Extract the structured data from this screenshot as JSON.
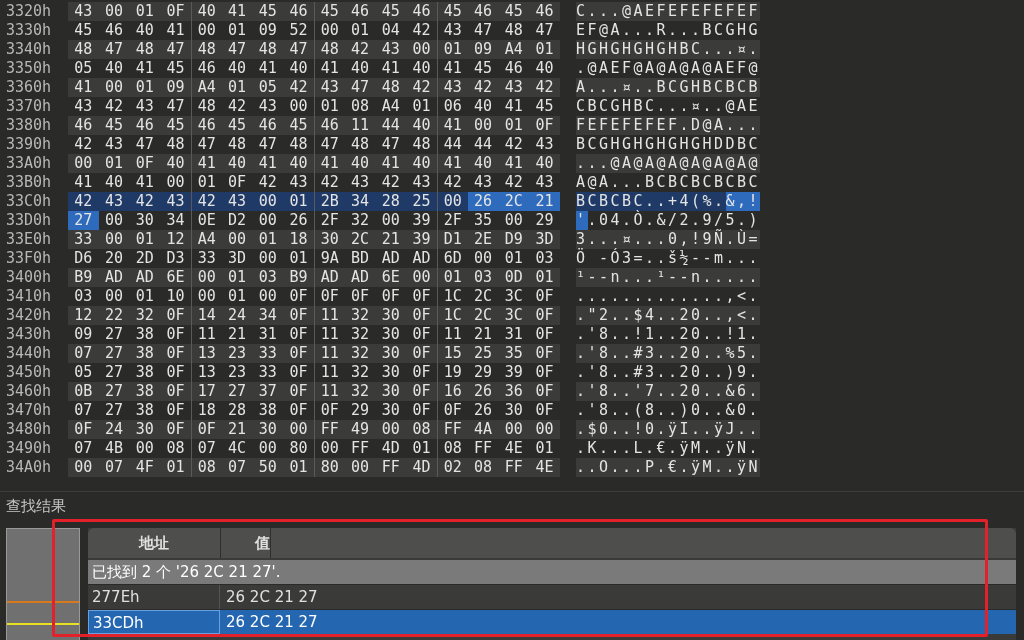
{
  "hex_view": {
    "rows": [
      {
        "offset": "3320h",
        "current": false,
        "hex": [
          {
            "bytes": "43 00 01 0F 40 41 45 46 45 46 45 46 45 46 45 46",
            "found": false
          }
        ],
        "ascii": [
          {
            "text": "C...@AEFEFEFEFEF",
            "found": false
          }
        ]
      },
      {
        "offset": "3330h",
        "current": false,
        "hex": [
          {
            "bytes": "45 46 40 41 00 01 09 52 00 01 04 42 43 47 48 47",
            "found": false
          }
        ],
        "ascii": [
          {
            "text": "EF@A...R...BCGHG",
            "found": false
          }
        ]
      },
      {
        "offset": "3340h",
        "current": false,
        "hex": [
          {
            "bytes": "48 47 48 47 48 47 48 47 48 42 43 00 01 09 A4 01",
            "found": false
          }
        ],
        "ascii": [
          {
            "text": "HGHGHGHGHBC...¤.",
            "found": false
          }
        ]
      },
      {
        "offset": "3350h",
        "current": false,
        "hex": [
          {
            "bytes": "05 40 41 45 46 40 41 40 41 40 41 40 41 45 46 40",
            "found": false
          }
        ],
        "ascii": [
          {
            "text": ".@AEF@A@A@A@AEF@",
            "found": false
          }
        ]
      },
      {
        "offset": "3360h",
        "current": false,
        "hex": [
          {
            "bytes": "41 00 01 09 A4 01 05 42 43 47 48 42 43 42 43 42",
            "found": false
          }
        ],
        "ascii": [
          {
            "text": "A...¤..BCGHBCBCB",
            "found": false
          }
        ]
      },
      {
        "offset": "3370h",
        "current": false,
        "hex": [
          {
            "bytes": "43 42 43 47 48 42 43 00 01 08 A4 01 06 40 41 45",
            "found": false
          }
        ],
        "ascii": [
          {
            "text": "CBCGHBC...¤..@AE",
            "found": false
          }
        ]
      },
      {
        "offset": "3380h",
        "current": false,
        "hex": [
          {
            "bytes": "46 45 46 45 46 45 46 45 46 11 44 40 41 00 01 0F",
            "found": false
          }
        ],
        "ascii": [
          {
            "text": "FEFEFEFEF.D@A...",
            "found": false
          }
        ]
      },
      {
        "offset": "3390h",
        "current": false,
        "hex": [
          {
            "bytes": "42 43 47 48 47 48 47 48 47 48 47 48 44 44 42 43",
            "found": false
          }
        ],
        "ascii": [
          {
            "text": "BCGHGHGHGHGHDDBC",
            "found": false
          }
        ]
      },
      {
        "offset": "33A0h",
        "current": false,
        "hex": [
          {
            "bytes": "00 01 0F 40 41 40 41 40 41 40 41 40 41 40 41 40",
            "found": false
          }
        ],
        "ascii": [
          {
            "text": "...@A@A@A@A@A@A@",
            "found": false
          }
        ]
      },
      {
        "offset": "33B0h",
        "current": false,
        "hex": [
          {
            "bytes": "41 40 41 00 01 0F 42 43 42 43 42 43 42 43 42 43",
            "found": false
          }
        ],
        "ascii": [
          {
            "text": "A@A...BCBCBCBCBC",
            "found": false
          }
        ]
      },
      {
        "offset": "33C0h",
        "current": true,
        "hex": [
          {
            "bytes": "42 43 42 43 42 43 00 01 2B 34 28 25 00",
            "found": false
          },
          {
            "bytes": "26 2C 21",
            "found": true
          }
        ],
        "ascii": [
          {
            "text": "BCBCBC..+4(%.",
            "found": false
          },
          {
            "text": "&,!",
            "found": true
          }
        ]
      },
      {
        "offset": "33D0h",
        "current": false,
        "hex": [
          {
            "bytes": "27",
            "found": true
          },
          {
            "bytes": "00 30 34 0E D2 00 26 2F 32 00 39 2F 35 00 29",
            "found": false
          }
        ],
        "ascii": [
          {
            "text": "'",
            "found": true
          },
          {
            "text": ".04.Ò.&/2.9/5.)",
            "found": false
          }
        ]
      },
      {
        "offset": "33E0h",
        "current": false,
        "hex": [
          {
            "bytes": "33 00 01 12 A4 00 01 18 30 2C 21 39 D1 2E D9 3D",
            "found": false
          }
        ],
        "ascii": [
          {
            "text": "3...¤...0,!9Ñ.Ù=",
            "found": false
          }
        ]
      },
      {
        "offset": "33F0h",
        "current": false,
        "hex": [
          {
            "bytes": "D6 20 2D D3 33 3D 00 01 9A BD AD AD 6D 00 01 03",
            "found": false
          }
        ],
        "ascii": [
          {
            "text": "Ö -Ó3=..š½--m...",
            "found": false
          }
        ]
      },
      {
        "offset": "3400h",
        "current": false,
        "hex": [
          {
            "bytes": "B9 AD AD 6E 00 01 03 B9 AD AD 6E 00 01 03 0D 01",
            "found": false
          }
        ],
        "ascii": [
          {
            "text": "¹--n...¹--n.....",
            "found": false
          }
        ]
      },
      {
        "offset": "3410h",
        "current": false,
        "hex": [
          {
            "bytes": "03 00 01 10 00 01 00 0F 0F 0F 0F 0F 1C 2C 3C 0F",
            "found": false
          }
        ],
        "ascii": [
          {
            "text": ".............,<.",
            "found": false
          }
        ]
      },
      {
        "offset": "3420h",
        "current": false,
        "hex": [
          {
            "bytes": "12 22 32 0F 14 24 34 0F 11 32 30 0F 1C 2C 3C 0F",
            "found": false
          }
        ],
        "ascii": [
          {
            "text": ".\"2..$4..20..,<.",
            "found": false
          }
        ]
      },
      {
        "offset": "3430h",
        "current": false,
        "hex": [
          {
            "bytes": "09 27 38 0F 11 21 31 0F 11 32 30 0F 11 21 31 0F",
            "found": false
          }
        ],
        "ascii": [
          {
            "text": ".'8..!1..20..!1.",
            "found": false
          }
        ]
      },
      {
        "offset": "3440h",
        "current": false,
        "hex": [
          {
            "bytes": "07 27 38 0F 13 23 33 0F 11 32 30 0F 15 25 35 0F",
            "found": false
          }
        ],
        "ascii": [
          {
            "text": ".'8..#3..20..%5.",
            "found": false
          }
        ]
      },
      {
        "offset": "3450h",
        "current": false,
        "hex": [
          {
            "bytes": "05 27 38 0F 13 23 33 0F 11 32 30 0F 19 29 39 0F",
            "found": false
          }
        ],
        "ascii": [
          {
            "text": ".'8..#3..20..)9.",
            "found": false
          }
        ]
      },
      {
        "offset": "3460h",
        "current": false,
        "hex": [
          {
            "bytes": "0B 27 38 0F 17 27 37 0F 11 32 30 0F 16 26 36 0F",
            "found": false
          }
        ],
        "ascii": [
          {
            "text": ".'8..'7..20..&6.",
            "found": false
          }
        ]
      },
      {
        "offset": "3470h",
        "current": false,
        "hex": [
          {
            "bytes": "07 27 38 0F 18 28 38 0F 0F 29 30 0F 0F 26 30 0F",
            "found": false
          }
        ],
        "ascii": [
          {
            "text": ".'8..(8..)0..&0.",
            "found": false
          }
        ]
      },
      {
        "offset": "3480h",
        "current": false,
        "hex": [
          {
            "bytes": "0F 24 30 0F 0F 21 30 00 FF 49 00 08 FF 4A 00 00",
            "found": false
          }
        ],
        "ascii": [
          {
            "text": ".$0..!0.ÿI..ÿJ..",
            "found": false
          }
        ]
      },
      {
        "offset": "3490h",
        "current": false,
        "hex": [
          {
            "bytes": "07 4B 00 08 07 4C 00 80 00 FF 4D 01 08 FF 4E 01",
            "found": false
          }
        ],
        "ascii": [
          {
            "text": ".K...L.€.ÿM..ÿN.",
            "found": false
          }
        ]
      },
      {
        "offset": "34A0h",
        "current": false,
        "hex": [
          {
            "bytes": "00 07 4F 01 08 07 50 01 80 00 FF 4D 02 08 FF 4E",
            "found": false
          }
        ],
        "ascii": [
          {
            "text": "..O...P.€.ÿM..ÿN",
            "found": false
          }
        ]
      }
    ]
  },
  "results_panel": {
    "title": "查找结果",
    "columns": [
      "地址",
      "值"
    ],
    "summary": "已找到 2 个 '26 2C 21 27'.",
    "rows": [
      {
        "address": "277Eh",
        "value": "26 2C 21 27",
        "selected": false
      },
      {
        "address": "33CDh",
        "value": "26 2C 21 27",
        "selected": true
      }
    ]
  }
}
